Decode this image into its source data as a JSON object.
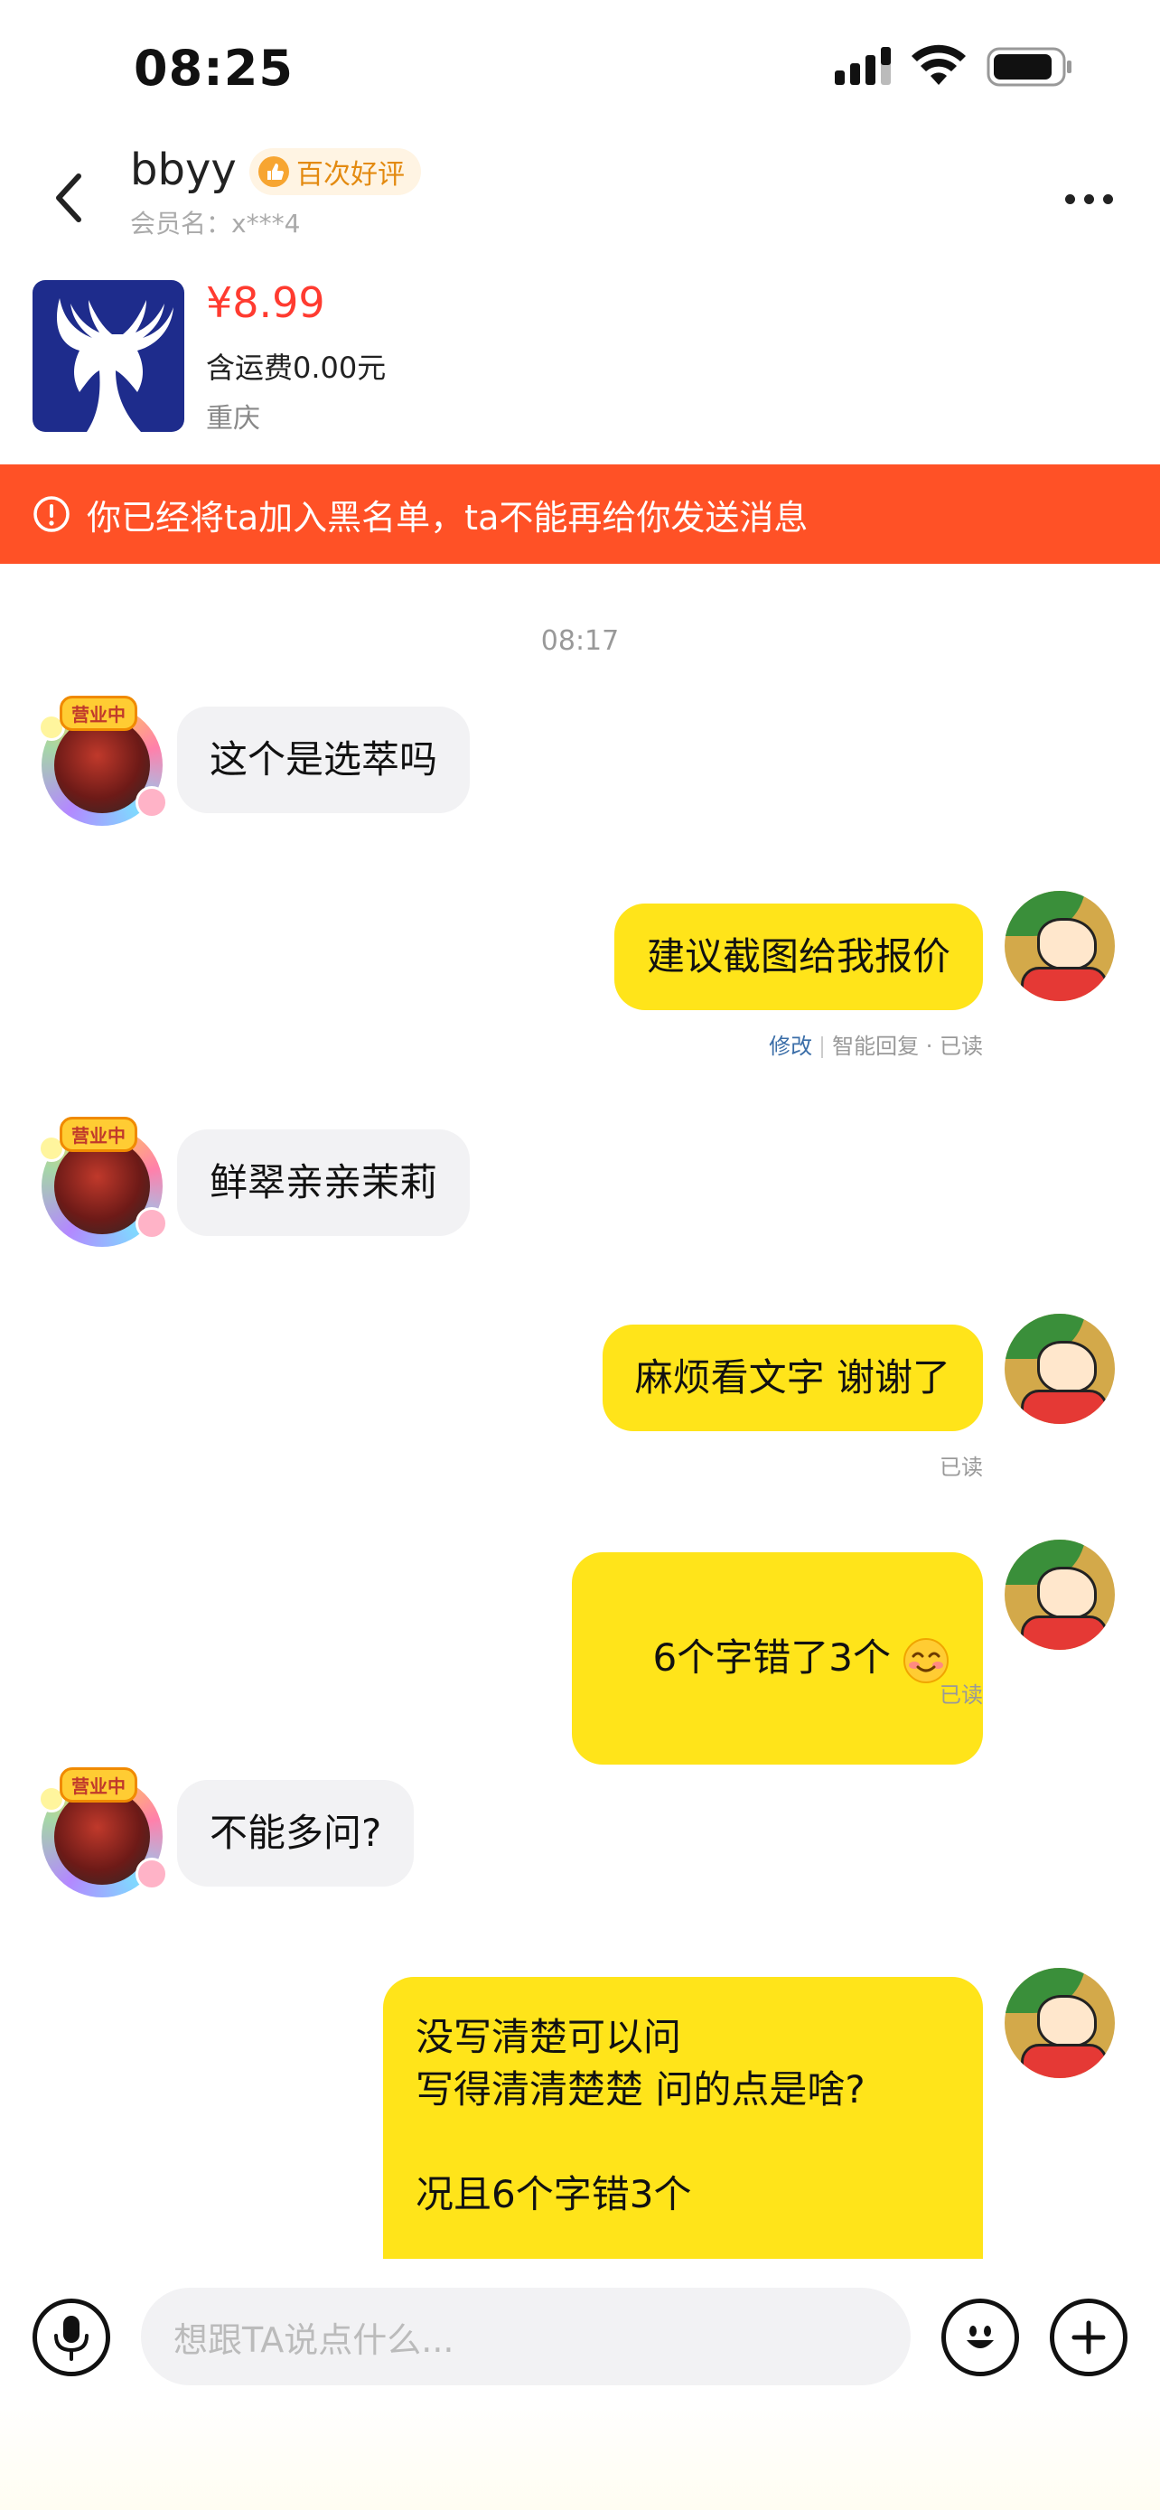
{
  "status_bar": {
    "time": "08:25"
  },
  "header": {
    "name": "bbyy",
    "badge": "百次好评",
    "member_label": "会员名：x***4"
  },
  "product": {
    "price": "¥8.99",
    "shipping": "含运费0.00元",
    "location": "重庆"
  },
  "warning": {
    "text": "你已经将ta加入黑名单，ta不能再给你发送消息"
  },
  "avatar_tag": "营业中",
  "chat": {
    "timestamp": "08:17",
    "messages": [
      {
        "side": "in",
        "text": "这个是选萃吗"
      },
      {
        "side": "out",
        "text": "建议截图给我报价",
        "meta_edit": "修改",
        "meta_rest": "智能回复 · 已读"
      },
      {
        "side": "in",
        "text": "鲜翠亲亲茉莉"
      },
      {
        "side": "out",
        "text": "麻烦看文字 谢谢了",
        "meta": "已读"
      },
      {
        "side": "out",
        "text": "6个字错了3个",
        "emoji": "smiling-face-emoji",
        "meta": "已读"
      },
      {
        "side": "in",
        "text": "不能多问?"
      },
      {
        "side": "out",
        "text": "没写清楚可以问\n写得清清楚楚 问的点是啥?\n\n况且6个字错3个"
      }
    ]
  },
  "input": {
    "placeholder": "想跟TA说点什么..."
  },
  "colors": {
    "accent_yellow": "#ffe41a",
    "warning": "#ff5126",
    "price": "#ff3b30"
  }
}
